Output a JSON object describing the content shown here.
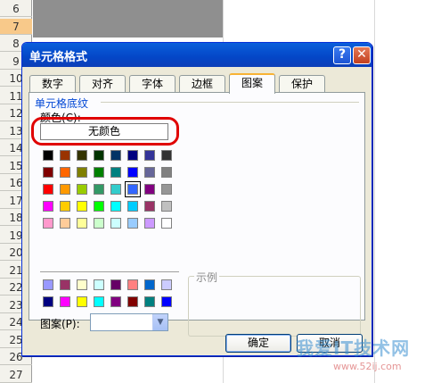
{
  "sheet": {
    "row_numbers": [
      "6",
      "7",
      "8",
      "9",
      "10",
      "11",
      "12",
      "13",
      "14",
      "15",
      "16",
      "17",
      "18",
      "19",
      "20",
      "21",
      "22",
      "23",
      "24",
      "25",
      "26",
      "27"
    ],
    "active_row": "7"
  },
  "dialog": {
    "title": "单元格格式",
    "help_glyph": "?",
    "close_glyph": "✕",
    "tabs": [
      "数字",
      "对齐",
      "字体",
      "边框",
      "图案",
      "保护"
    ],
    "active_tab": "图案",
    "section_title": "单元格底纹",
    "color_label": "颜色(C):",
    "no_color_button": "无颜色",
    "palette_main": [
      [
        "#000000",
        "#993300",
        "#333300",
        "#003300",
        "#003366",
        "#000080",
        "#333399",
        "#333333"
      ],
      [
        "#800000",
        "#FF6600",
        "#808000",
        "#008000",
        "#008080",
        "#0000FF",
        "#666699",
        "#808080"
      ],
      [
        "#FF0000",
        "#FF9900",
        "#99CC00",
        "#339966",
        "#33CCCC",
        "#3366FF",
        "#800080",
        "#969696"
      ],
      [
        "#FF00FF",
        "#FFCC00",
        "#FFFF00",
        "#00FF00",
        "#00FFFF",
        "#00CCFF",
        "#993366",
        "#C0C0C0"
      ],
      [
        "#FF99CC",
        "#FFCC99",
        "#FFFF99",
        "#CCFFCC",
        "#CCFFFF",
        "#99CCFF",
        "#CC99FF",
        "#FFFFFF"
      ]
    ],
    "palette_extra": [
      [
        "#9999FF",
        "#993366",
        "#FFFFCC",
        "#CCFFFF",
        "#660066",
        "#FF8080",
        "#0066CC",
        "#CCCCFF"
      ],
      [
        "#000080",
        "#FF00FF",
        "#FFFF00",
        "#00FFFF",
        "#800080",
        "#800000",
        "#008080",
        "#0000FF"
      ]
    ],
    "selected_swatch": "#3366FF",
    "pattern_label": "图案(P):",
    "pattern_value": "",
    "sample_label": "示例",
    "ok_button": "确定",
    "cancel_button": "取消"
  },
  "watermark": {
    "text": "我爱IT技术网",
    "url": "www.52ij.com"
  },
  "colors": {
    "title_bar": "#0a5fdb",
    "dialog_bg": "#ece9d8",
    "highlight": "#e00000",
    "section_title": "#0046d5"
  }
}
